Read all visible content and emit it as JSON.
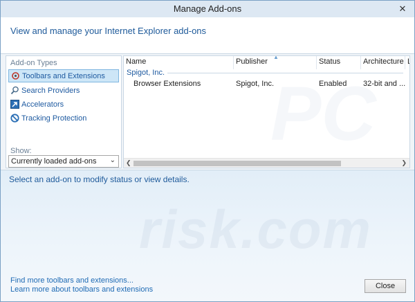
{
  "window": {
    "title": "Manage Add-ons"
  },
  "header": {
    "text": "View and manage your Internet Explorer add-ons"
  },
  "sidebar": {
    "types_label": "Add-on Types",
    "items": [
      {
        "label": "Toolbars and Extensions",
        "icon": "gear-icon",
        "selected": true
      },
      {
        "label": "Search Providers",
        "icon": "search-icon",
        "selected": false
      },
      {
        "label": "Accelerators",
        "icon": "accelerator-icon",
        "selected": false
      },
      {
        "label": "Tracking Protection",
        "icon": "tracking-protection-icon",
        "selected": false
      }
    ],
    "show_label": "Show:",
    "show_value": "Currently loaded add-ons"
  },
  "table": {
    "columns": [
      "Name",
      "Publisher",
      "Status",
      "Architecture",
      "L"
    ],
    "group": "Spigot, Inc.",
    "rows": [
      {
        "name": "Browser Extensions",
        "publisher": "Spigot, Inc.",
        "status": "Enabled",
        "architecture": "32-bit and ..."
      }
    ]
  },
  "details": {
    "text": "Select an add-on to modify status or view details."
  },
  "watermark": {
    "top": "PC",
    "bottom": "risk.com"
  },
  "footer": {
    "link1": "Find more toolbars and extensions...",
    "link2": "Learn more about toolbars and extensions",
    "close_label": "Close"
  },
  "colors": {
    "accent": "#1e5a9a",
    "selection": "#cde6f7",
    "link": "#1e6ab4"
  }
}
